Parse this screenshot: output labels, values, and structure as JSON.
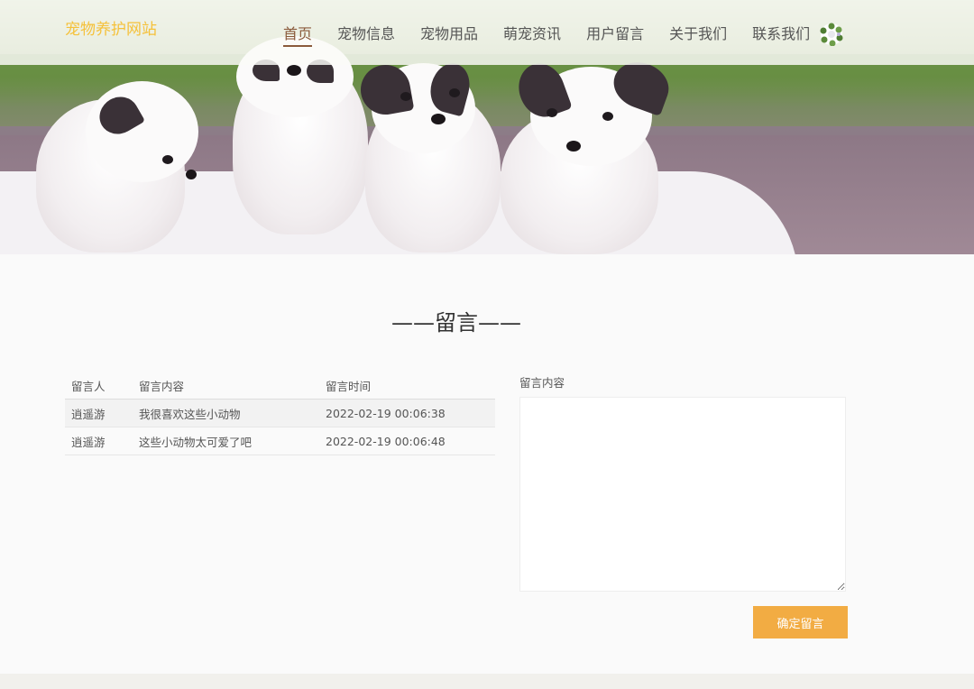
{
  "header": {
    "logo": "宠物养护网站",
    "nav": [
      {
        "label": "首页",
        "active": true
      },
      {
        "label": "宠物信息"
      },
      {
        "label": "宠物用品"
      },
      {
        "label": "萌宠资讯"
      },
      {
        "label": "用户留言"
      },
      {
        "label": "关于我们"
      },
      {
        "label": "联系我们"
      }
    ],
    "avatar_icon": "flower-wreath-avatar-icon"
  },
  "colors": {
    "logo": "#f5c13a",
    "nav_active": "#8a5a3b",
    "button": "#f2ac43"
  },
  "section": {
    "title": "——留言——"
  },
  "table": {
    "headers": [
      "留言人",
      "留言内容",
      "留言时间"
    ],
    "rows": [
      {
        "user": "逍遥游",
        "content": "我很喜欢这些小动物",
        "time": "2022-02-19 00:06:38"
      },
      {
        "user": "逍遥游",
        "content": "这些小动物太可爱了吧",
        "time": "2022-02-19 00:06:48"
      }
    ]
  },
  "form": {
    "label": "留言内容",
    "value": "",
    "submit_label": "确定留言"
  }
}
